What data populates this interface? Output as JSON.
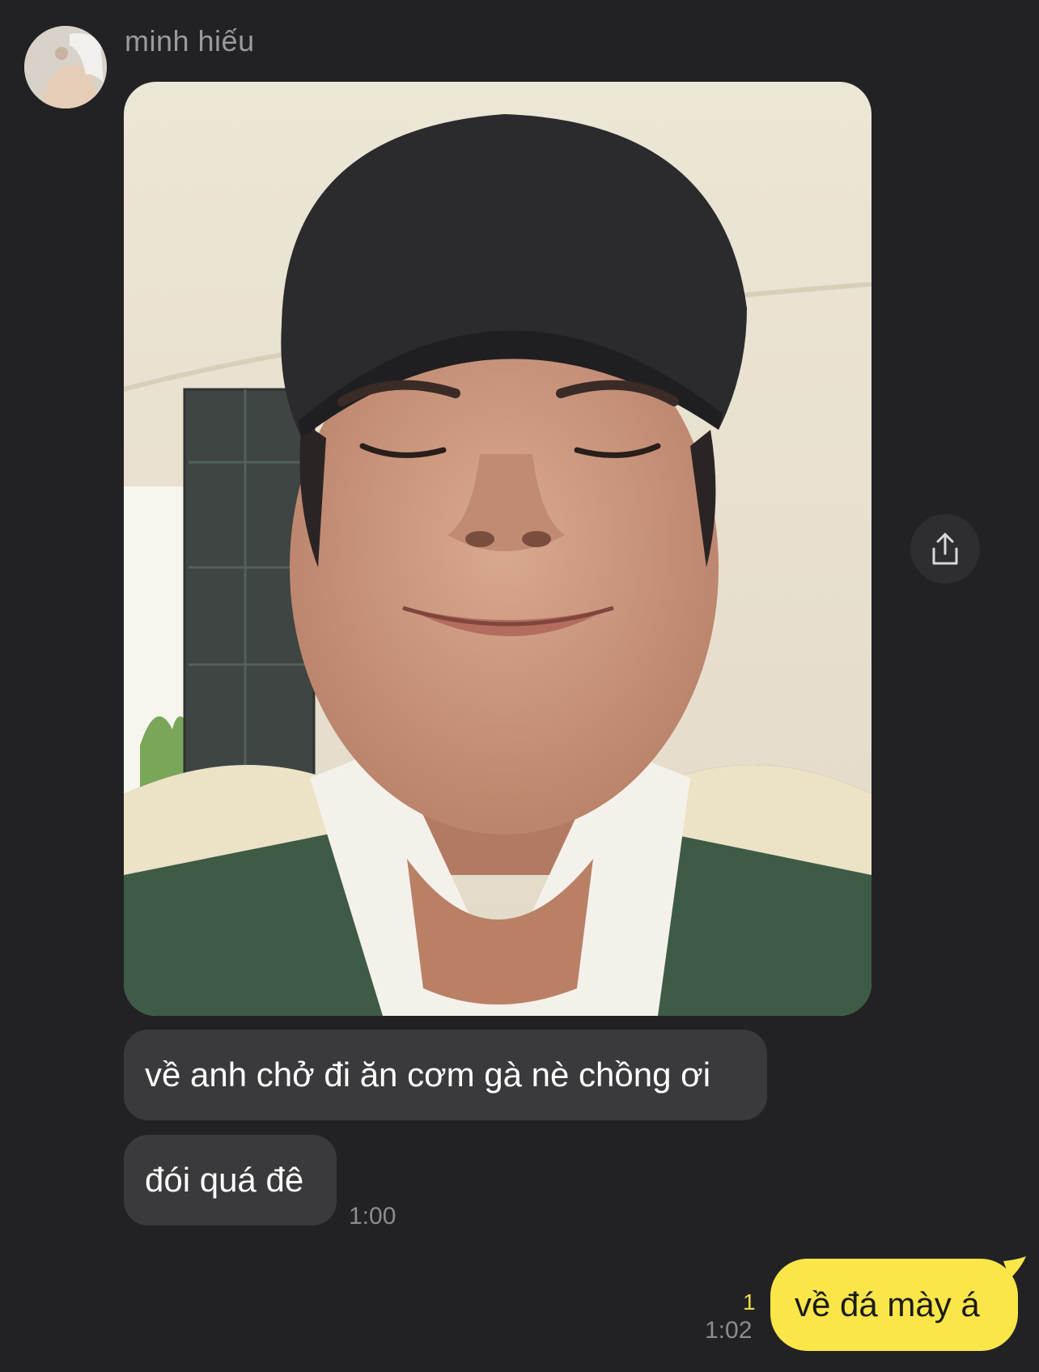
{
  "sender": {
    "name": "minh hiếu",
    "avatar_icon": "profile-avatar"
  },
  "messages": {
    "incoming_photo": {
      "share_icon": "share-icon"
    },
    "incoming_texts": [
      {
        "text": "về anh chở đi ăn cơm gà nè chồng ơi"
      },
      {
        "text": "đói quá đê"
      }
    ],
    "incoming_time": "1:00",
    "outgoing": {
      "text": "về đá mày á",
      "unread_count": "1",
      "time": "1:02"
    }
  },
  "colors": {
    "background": "#222224",
    "incoming_bubble": "#3a3a3d",
    "outgoing_bubble": "#fbe64a",
    "unread_count": "#f5d94a"
  }
}
